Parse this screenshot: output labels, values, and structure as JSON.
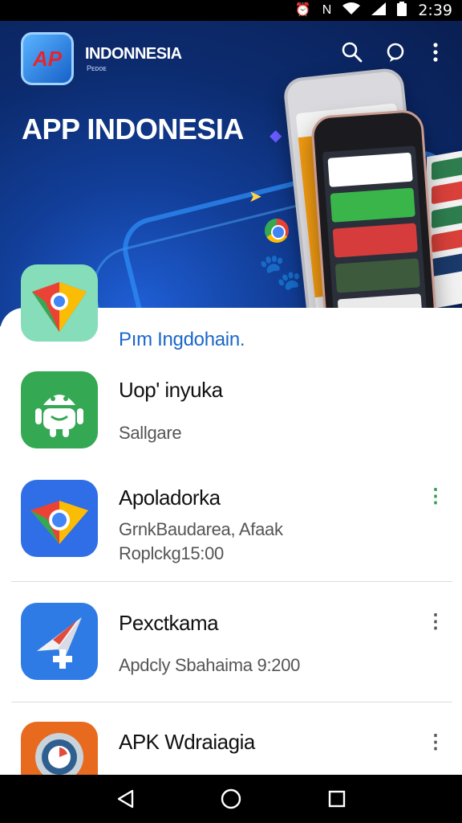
{
  "status_bar": {
    "time": "2:39",
    "icons": [
      "alarm-icon",
      "nfc-icon",
      "wifi-icon",
      "signal-icon",
      "battery-icon"
    ]
  },
  "header": {
    "logo_text": "AP",
    "brand_name": "INDONNESIA",
    "brand_sub": "Pᴇᴅᴏᴇ",
    "title": "APP INDONESIA",
    "icons": [
      "search-icon",
      "chat-icon",
      "more-vert-icon"
    ]
  },
  "list": {
    "items": [
      {
        "subtitle_link": "Pım Ingdohain.",
        "icon": "maps-pin-icon",
        "colors": [
          "#7fd8b4",
          "#ea4335",
          "#fbbc05"
        ]
      },
      {
        "title": "Uop' inyuka",
        "subtitle": "Sallgare",
        "icon": "android-icon",
        "colors": [
          "#34a853",
          "#ffffff"
        ]
      },
      {
        "title": "Apoladorka",
        "subtitle_lines": [
          "GrnkBaudarea, Afaak",
          "Roplckg15:00"
        ],
        "icon": "chrome-icon",
        "colors": [
          "#2f6ee6"
        ],
        "menu_color": "#2e9b4e"
      },
      {
        "title": "Pexctkama",
        "subtitle": "Apdcly Sbahaima 9:200",
        "icon": "navigation-icon",
        "colors": [
          "#2f7be6"
        ],
        "menu_color": "#555555"
      },
      {
        "title": "APK Wdraiagia",
        "subtitle": "",
        "icon": "gauge-icon",
        "colors": [
          "#e86a1f"
        ],
        "menu_color": "#555555"
      }
    ]
  },
  "nav_bar": {
    "icons": [
      "back-icon",
      "home-icon",
      "recents-icon"
    ]
  },
  "colors": {
    "accent": "#1a67c9",
    "hero_dark": "#0a1f52",
    "hero_light": "#1f5fd6"
  }
}
